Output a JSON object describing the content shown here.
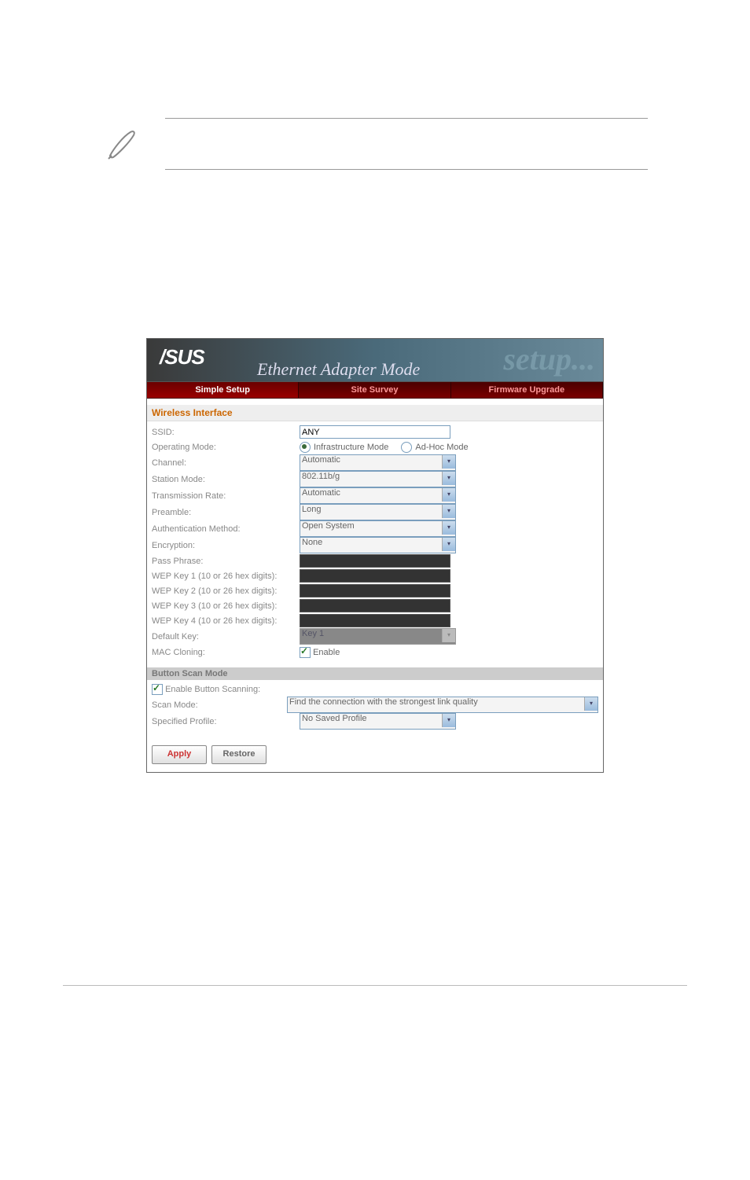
{
  "header": {
    "logo_text": "/SUS",
    "mode_title": "Ethernet Adapter Mode",
    "setup_text": "setup..."
  },
  "tabs": {
    "simple_setup": "Simple Setup",
    "site_survey": "Site Survey",
    "firmware_upgrade": "Firmware Upgrade"
  },
  "wireless_section": {
    "title": "Wireless Interface",
    "ssid_label": "SSID:",
    "ssid_value": "ANY",
    "operating_mode_label": "Operating Mode:",
    "infra_label": "Infrastructure Mode",
    "adhoc_label": "Ad-Hoc Mode",
    "channel_label": "Channel:",
    "channel_value": "Automatic",
    "station_mode_label": "Station Mode:",
    "station_mode_value": "802.11b/g",
    "tx_rate_label": "Transmission Rate:",
    "tx_rate_value": "Automatic",
    "preamble_label": "Preamble:",
    "preamble_value": "Long",
    "auth_label": "Authentication Method:",
    "auth_value": "Open System",
    "encryption_label": "Encryption:",
    "encryption_value": "None",
    "passphrase_label": "Pass Phrase:",
    "wep1_label": "WEP Key 1 (10 or 26 hex digits):",
    "wep2_label": "WEP Key 2 (10 or 26 hex digits):",
    "wep3_label": "WEP Key 3 (10 or 26 hex digits):",
    "wep4_label": "WEP Key 4 (10 or 26 hex digits):",
    "default_key_label": "Default Key:",
    "default_key_value": "Key 1",
    "mac_cloning_label": "MAC Cloning:",
    "mac_cloning_enable": "Enable"
  },
  "button_scan_section": {
    "title": "Button Scan Mode",
    "enable_label": "Enable Button Scanning:",
    "scan_mode_label": "Scan Mode:",
    "scan_mode_value": "Find the connection with the strongest link quality",
    "profile_label": "Specified Profile:",
    "profile_value": "No Saved Profile"
  },
  "buttons": {
    "apply": "Apply",
    "restore": "Restore"
  }
}
